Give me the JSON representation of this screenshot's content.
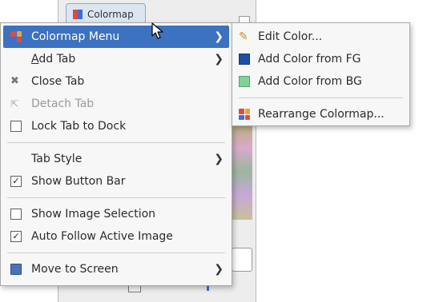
{
  "background": {
    "tab_label": "Colormap"
  },
  "main_menu": {
    "items": [
      {
        "type": "item",
        "key": "colormap",
        "label": "Colormap Menu",
        "icon": "colormap-icon",
        "submenu": true,
        "highlighted": true
      },
      {
        "type": "item",
        "key": "addtab",
        "label": "Add Tab",
        "icon": "",
        "submenu": true
      },
      {
        "type": "item",
        "key": "closetab",
        "label": "Close Tab",
        "icon": "close-icon"
      },
      {
        "type": "item",
        "key": "detachtab",
        "label": "Detach Tab",
        "icon": "detach-icon",
        "disabled": true
      },
      {
        "type": "check",
        "key": "lock",
        "label": "Lock Tab to Dock",
        "checked": false
      },
      {
        "type": "sep"
      },
      {
        "type": "item",
        "key": "tabstyle",
        "label": "Tab Style",
        "icon": "",
        "submenu": true
      },
      {
        "type": "check",
        "key": "buttonbar",
        "label": "Show Button Bar",
        "checked": true
      },
      {
        "type": "sep"
      },
      {
        "type": "check",
        "key": "imagesel",
        "label": "Show Image Selection",
        "checked": false
      },
      {
        "type": "check",
        "key": "autofollow",
        "label": "Auto Follow Active Image",
        "checked": true
      },
      {
        "type": "sep"
      },
      {
        "type": "item",
        "key": "movescreen",
        "label": "Move to Screen",
        "icon": "screen-icon",
        "submenu": true
      }
    ]
  },
  "sub_menu": {
    "items": [
      {
        "type": "item",
        "key": "editcolor",
        "label": "Edit Color...",
        "icon": "edit-icon",
        "color": "#e0a030"
      },
      {
        "type": "item",
        "key": "addfg",
        "label": "Add Color from FG",
        "icon": "fg-swatch-icon",
        "color": "#1f4fa3"
      },
      {
        "type": "item",
        "key": "addbg",
        "label": "Add Color from BG",
        "icon": "bg-swatch-icon",
        "color": "#7fd39a"
      },
      {
        "type": "sep"
      },
      {
        "type": "item",
        "key": "rearrange",
        "label": "Rearrange Colormap...",
        "icon": "colormap-icon"
      }
    ]
  },
  "colors": {
    "highlight": "#3c72c0",
    "menu_bg": "#f7f7f7"
  }
}
